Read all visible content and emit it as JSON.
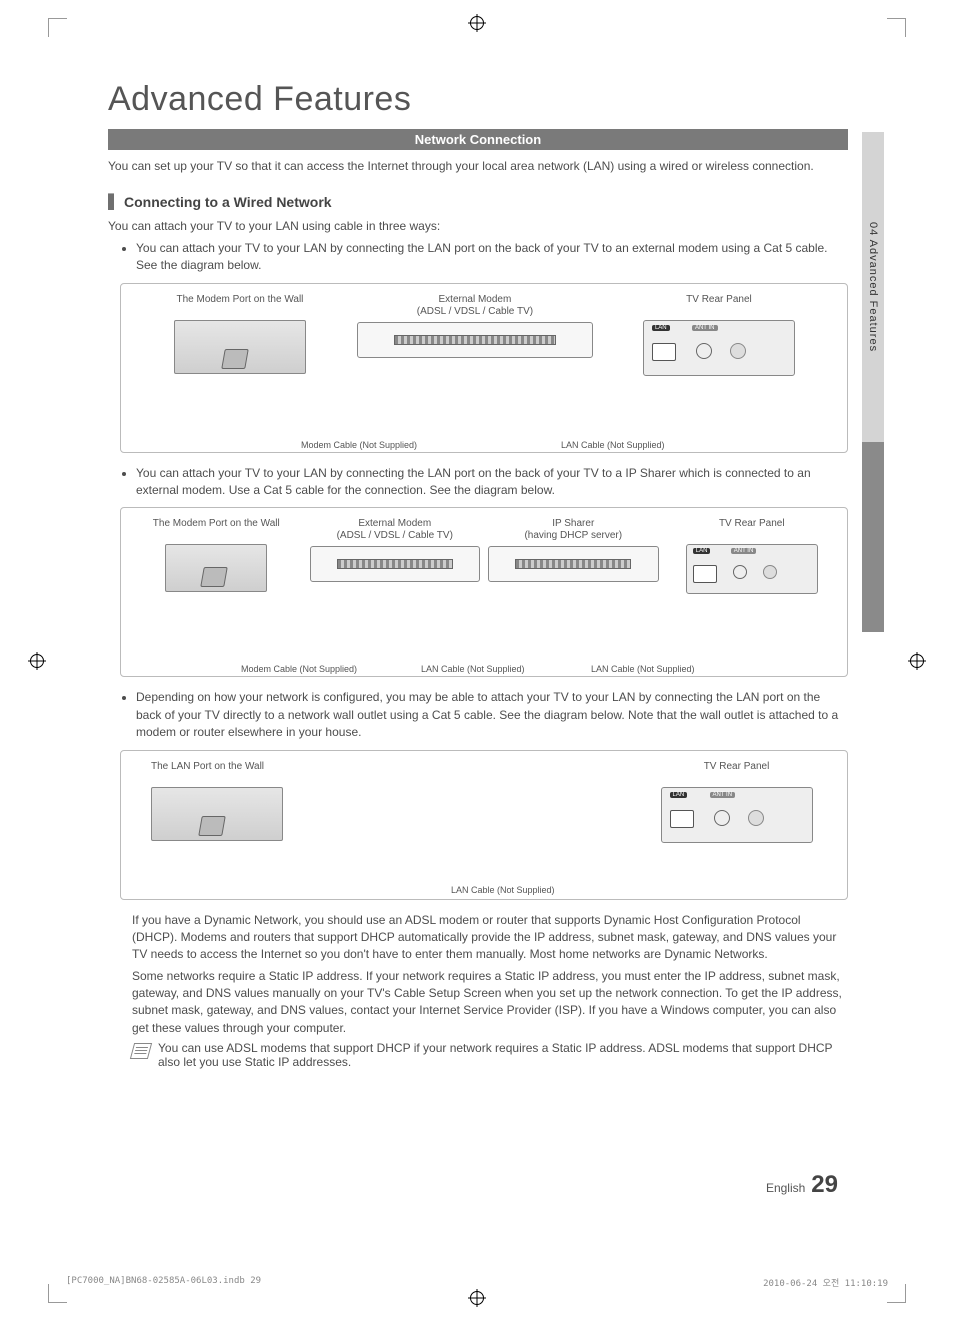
{
  "title": "Advanced Features",
  "section_bar": "Network Connection",
  "intro": "You can set up your TV so that it can access the Internet through your local area network (LAN) using a wired or wireless connection.",
  "subhead": "Connecting to a Wired Network",
  "lead_line": "You can attach your TV to your LAN using cable in three ways:",
  "bullets": {
    "b1": "You can attach your TV to your LAN by connecting the LAN port on the back of your TV to an external modem using a Cat 5 cable. See the diagram below.",
    "b2": "You can attach your TV to your LAN by connecting the LAN port on the back of your TV to a IP Sharer which is connected to an external modem. Use a Cat 5 cable for the connection. See the diagram below.",
    "b3": "Depending on how your network is configured, you may be able to attach your TV to your LAN by connecting the LAN port on the back of your TV directly to a network wall outlet using a Cat 5 cable. See the diagram below. Note that the wall outlet is attached to a modem or router elsewhere in your house."
  },
  "diagram_labels": {
    "modem_port_wall": "The Modem Port on the Wall",
    "lan_port_wall": "The LAN Port on the Wall",
    "external_modem_l1": "External Modem",
    "external_modem_l2": "(ADSL / VDSL / Cable TV)",
    "ip_sharer_l1": "IP Sharer",
    "ip_sharer_l2": "(having DHCP server)",
    "tv_rear": "TV Rear Panel",
    "modem_cable": "Modem Cable (Not Supplied)",
    "lan_cable": "LAN Cable (Not Supplied)",
    "lan_port_lbl": "LAN",
    "ant_lbl": "ANT IN"
  },
  "para1": "If you have a Dynamic Network, you should use an ADSL modem or router that supports Dynamic Host Configuration Protocol (DHCP). Modems and routers that support DHCP automatically provide the IP address, subnet mask, gateway, and DNS values your TV needs to access the Internet so you don't have to enter them manually. Most home networks are Dynamic Networks.",
  "para2": "Some networks require a Static IP address. If your network requires a Static IP address, you must enter the IP address, subnet mask, gateway, and DNS values manually on your TV's Cable Setup Screen when you set up the network connection. To get the IP address, subnet mask, gateway, and DNS values, contact your Internet Service Provider (ISP). If you have a Windows computer, you can also get these values through your computer.",
  "note": "You can use ADSL modems that support DHCP if your network requires a Static IP address. ADSL modems that support DHCP also let you use Static IP addresses.",
  "side_tab": "04   Advanced Features",
  "footer_lang": "English",
  "footer_page": "29",
  "print_left": "[PC7000_NA]BN68-02585A-06L03.indb   29",
  "print_right": "2010-06-24   오전 11:10:19"
}
